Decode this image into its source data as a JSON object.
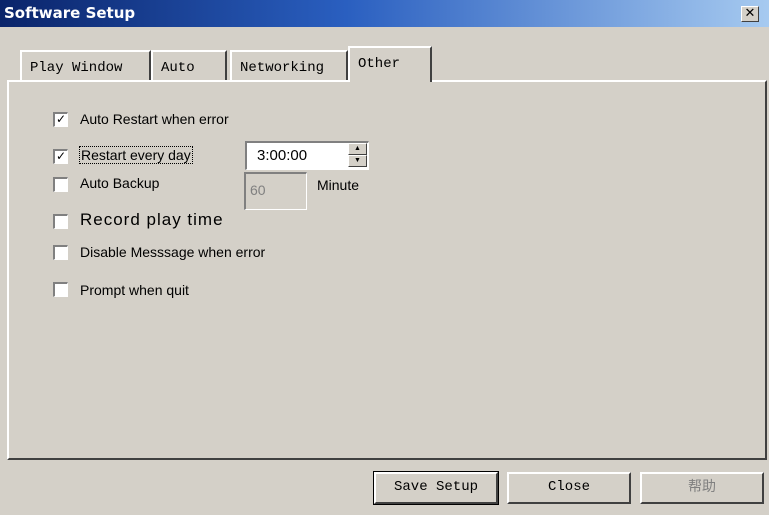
{
  "window": {
    "title": "Software Setup",
    "close_glyph": "✕"
  },
  "tabs": [
    {
      "label": "Play Window",
      "active": false
    },
    {
      "label": "Auto",
      "active": false
    },
    {
      "label": "Networking",
      "active": false
    },
    {
      "label": "Other",
      "active": true
    }
  ],
  "options": {
    "auto_restart": {
      "label": "Auto Restart when error",
      "checked": true
    },
    "restart_every_day": {
      "label": "Restart every day",
      "checked": true,
      "time": "3:00:00"
    },
    "auto_backup": {
      "label": "Auto Backup",
      "checked": false,
      "value": "60",
      "unit": "Minute"
    },
    "record_play_time": {
      "label": "Record play time",
      "checked": false
    },
    "disable_message": {
      "label": "Disable Messsage when error",
      "checked": false
    },
    "prompt_quit": {
      "label": "Prompt when quit",
      "checked": false
    }
  },
  "buttons": {
    "save": "Save Setup",
    "close": "Close",
    "help": "帮助"
  },
  "glyphs": {
    "check": "✓",
    "spin_up": "▲",
    "spin_down": "▼"
  }
}
